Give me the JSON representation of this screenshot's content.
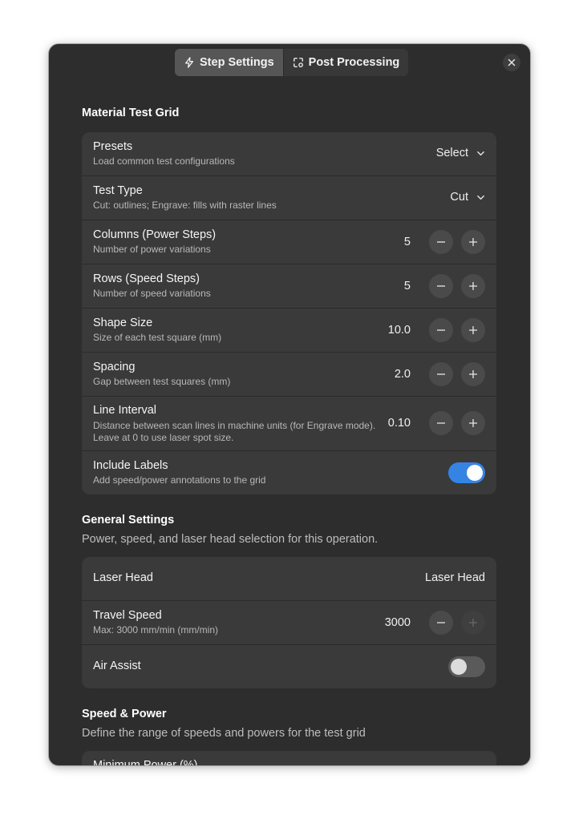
{
  "header": {
    "tabs": [
      {
        "label": "Step Settings",
        "icon": "lightning-icon",
        "active": true
      },
      {
        "label": "Post Processing",
        "icon": "transform-icon",
        "active": false
      }
    ],
    "close_icon": "close-icon"
  },
  "material_test_grid": {
    "title": "Material Test Grid",
    "rows": [
      {
        "title": "Presets",
        "subtitle": "Load common test configurations",
        "control": "dropdown",
        "value": "Select"
      },
      {
        "title": "Test Type",
        "subtitle": "Cut: outlines; Engrave: fills with raster lines",
        "control": "dropdown",
        "value": "Cut"
      },
      {
        "title": "Columns (Power Steps)",
        "subtitle": "Number of power variations",
        "control": "stepper",
        "value": "5"
      },
      {
        "title": "Rows (Speed Steps)",
        "subtitle": "Number of speed variations",
        "control": "stepper",
        "value": "5"
      },
      {
        "title": "Shape Size",
        "subtitle": "Size of each test square (mm)",
        "control": "stepper",
        "value": "10.0"
      },
      {
        "title": "Spacing",
        "subtitle": "Gap between test squares (mm)",
        "control": "stepper",
        "value": "2.0"
      },
      {
        "title": "Line Interval",
        "subtitle_line1": "Distance between scan lines in machine units (for Engrave mode).",
        "subtitle_line2": "Leave at 0 to use laser spot size.",
        "control": "stepper",
        "value": "0.10"
      },
      {
        "title": "Include Labels",
        "subtitle": "Add speed/power annotations to the grid",
        "control": "toggle",
        "enabled": true
      }
    ]
  },
  "general_settings": {
    "title": "General Settings",
    "description": "Power, speed, and laser head selection for this operation.",
    "rows": [
      {
        "title": "Laser Head",
        "value": "Laser Head"
      },
      {
        "title": "Travel Speed",
        "subtitle": "Max: 3000 mm/min (mm/min)",
        "value": "3000",
        "plus_enabled": false
      },
      {
        "title": "Air Assist",
        "enabled": false
      }
    ]
  },
  "speed_power": {
    "title": "Speed & Power",
    "description": "Define the range of speeds and powers for the test grid",
    "rows": [
      {
        "title": "Minimum Power (%)"
      }
    ]
  },
  "colors": {
    "window_bg": "#2d2d2d",
    "card_bg": "#3a3a3a",
    "accent": "#3584e4"
  }
}
